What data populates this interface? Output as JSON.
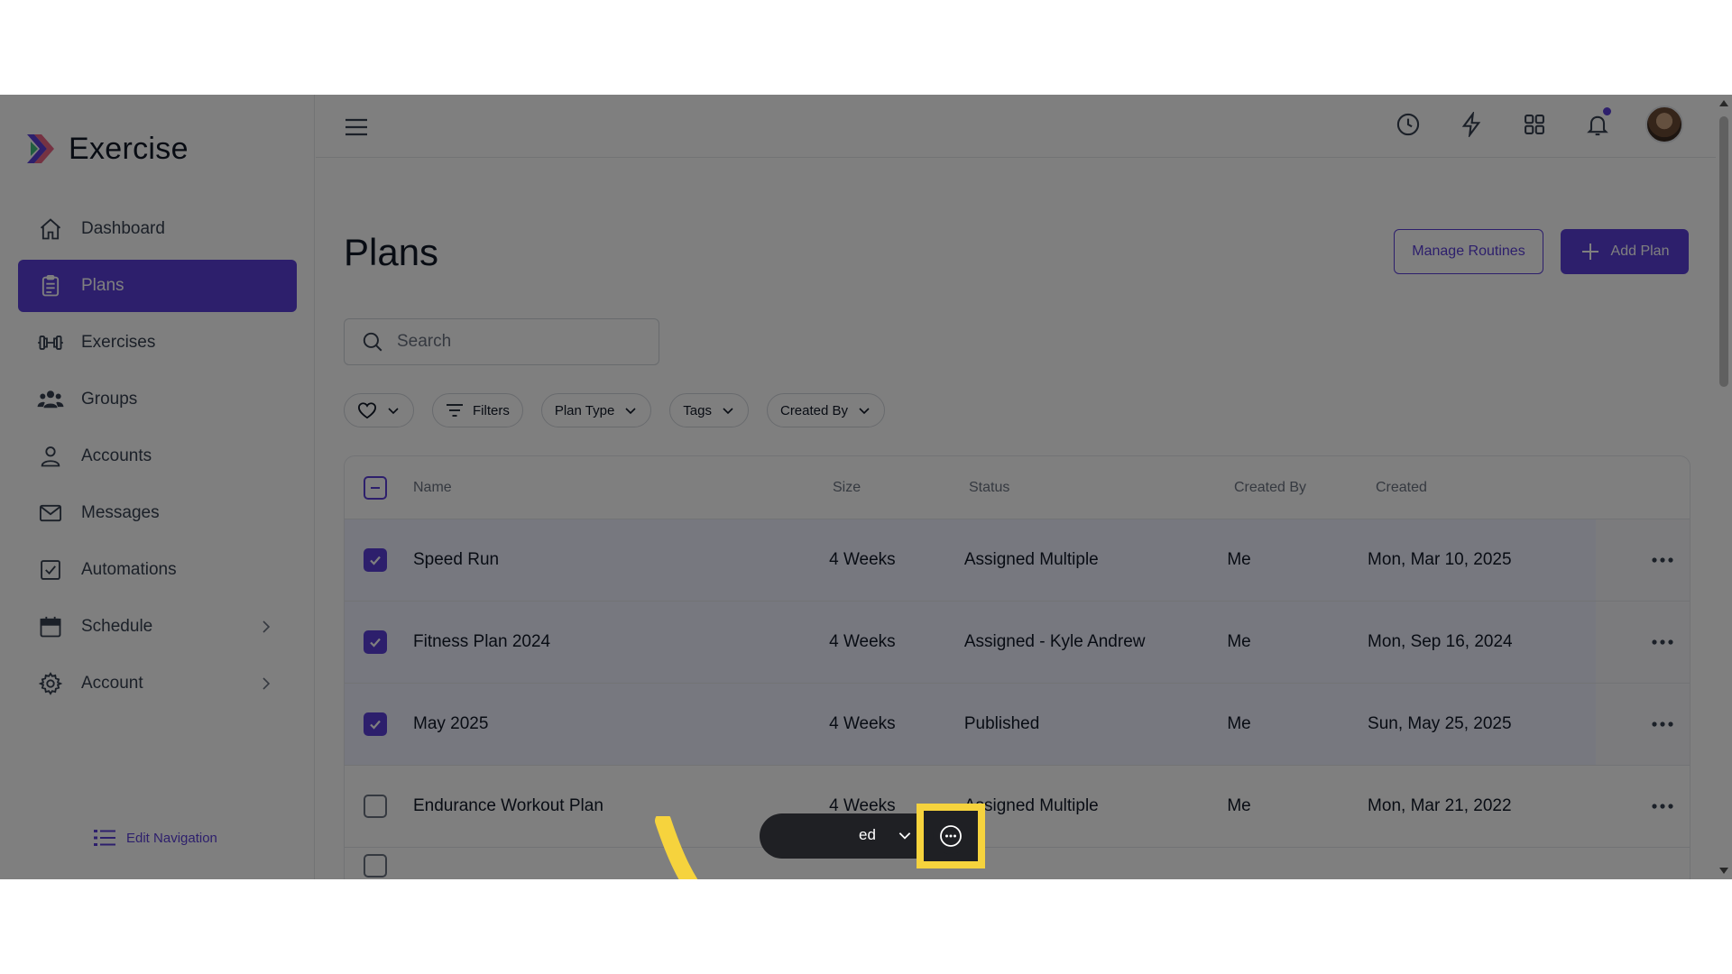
{
  "app": {
    "name": "Exercise"
  },
  "sidebar": {
    "items": [
      {
        "label": "Dashboard",
        "icon": "home-icon",
        "active": false
      },
      {
        "label": "Plans",
        "icon": "clipboard-icon",
        "active": true
      },
      {
        "label": "Exercises",
        "icon": "dumbbell-icon",
        "active": false
      },
      {
        "label": "Groups",
        "icon": "users-icon",
        "active": false
      },
      {
        "label": "Accounts",
        "icon": "user-icon",
        "active": false
      },
      {
        "label": "Messages",
        "icon": "mail-icon",
        "active": false
      },
      {
        "label": "Automations",
        "icon": "checkbox-icon",
        "active": false
      },
      {
        "label": "Schedule",
        "icon": "calendar-icon",
        "active": false,
        "has_submenu": true
      },
      {
        "label": "Account",
        "icon": "gear-icon",
        "active": false,
        "has_submenu": true
      }
    ],
    "edit_navigation": "Edit Navigation"
  },
  "page": {
    "title": "Plans",
    "manage_routines": "Manage Routines",
    "add_plan": "Add Plan",
    "search_placeholder": "Search",
    "filters": {
      "favorites": "",
      "filters": "Filters",
      "plan_type": "Plan Type",
      "tags": "Tags",
      "created_by": "Created By"
    }
  },
  "table": {
    "headers": {
      "name": "Name",
      "size": "Size",
      "status": "Status",
      "created_by": "Created By",
      "created": "Created"
    },
    "rows": [
      {
        "name": "Speed Run",
        "size": "4 Weeks",
        "status": "Assigned Multiple",
        "created_by": "Me",
        "created": "Mon, Mar 10, 2025",
        "checked": true
      },
      {
        "name": "Fitness Plan 2024",
        "size": "4 Weeks",
        "status": "Assigned - Kyle Andrew",
        "created_by": "Me",
        "created": "Mon, Sep 16, 2024",
        "checked": true
      },
      {
        "name": "May 2025",
        "size": "4 Weeks",
        "status": "Published",
        "created_by": "Me",
        "created": "Sun, May 25, 2025",
        "checked": true
      },
      {
        "name": "Endurance Workout Plan",
        "size": "4 Weeks",
        "status": "Assigned Multiple",
        "created_by": "Me",
        "created": "Mon, Mar 21, 2022",
        "checked": false
      }
    ]
  },
  "bulk_bar": {
    "selected_text": "ed"
  },
  "colors": {
    "accent": "#5b3fd9",
    "highlight": "#f6d33d"
  }
}
